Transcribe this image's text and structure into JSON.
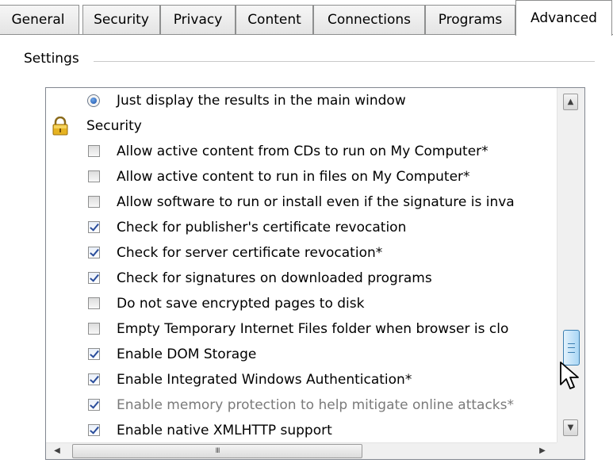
{
  "tabs": [
    {
      "label": "General",
      "active": false
    },
    {
      "label": "Security",
      "active": false
    },
    {
      "label": "Privacy",
      "active": false
    },
    {
      "label": "Content",
      "active": false
    },
    {
      "label": "Connections",
      "active": false
    },
    {
      "label": "Programs",
      "active": false
    },
    {
      "label": "Advanced",
      "active": true
    }
  ],
  "settings": {
    "group_label": "Settings",
    "rows": [
      {
        "type": "radio",
        "checked": true,
        "label": "Just display the results in the main window"
      },
      {
        "type": "category",
        "icon": "lock-icon",
        "label": "Security"
      },
      {
        "type": "checkbox",
        "checked": false,
        "label": "Allow active content from CDs to run on My Computer*"
      },
      {
        "type": "checkbox",
        "checked": false,
        "label": "Allow active content to run in files on My Computer*"
      },
      {
        "type": "checkbox",
        "checked": false,
        "label": "Allow software to run or install even if the signature is inva"
      },
      {
        "type": "checkbox",
        "checked": true,
        "label": "Check for publisher's certificate revocation"
      },
      {
        "type": "checkbox",
        "checked": true,
        "label": "Check for server certificate revocation*"
      },
      {
        "type": "checkbox",
        "checked": true,
        "label": "Check for signatures on downloaded programs"
      },
      {
        "type": "checkbox",
        "checked": false,
        "label": "Do not save encrypted pages to disk"
      },
      {
        "type": "checkbox",
        "checked": false,
        "label": "Empty Temporary Internet Files folder when browser is clo"
      },
      {
        "type": "checkbox",
        "checked": true,
        "label": "Enable DOM Storage"
      },
      {
        "type": "checkbox",
        "checked": true,
        "label": "Enable Integrated Windows Authentication*"
      },
      {
        "type": "checkbox",
        "checked": true,
        "disabled": true,
        "label": "Enable memory protection to help mitigate online attacks*"
      },
      {
        "type": "checkbox",
        "checked": true,
        "label": "Enable native XMLHTTP support"
      }
    ]
  },
  "scrollbars": {
    "up_arrow_icon": "chevron-up-icon",
    "down_arrow_icon": "chevron-down-icon",
    "left_arrow_icon": "chevron-left-icon",
    "right_arrow_icon": "chevron-right-icon",
    "h_thumb_grip": "III"
  },
  "colors": {
    "accent_check": "#2a4d9b",
    "thumb_border": "#3c7fb1",
    "lock_gold": "#d9a21b"
  }
}
